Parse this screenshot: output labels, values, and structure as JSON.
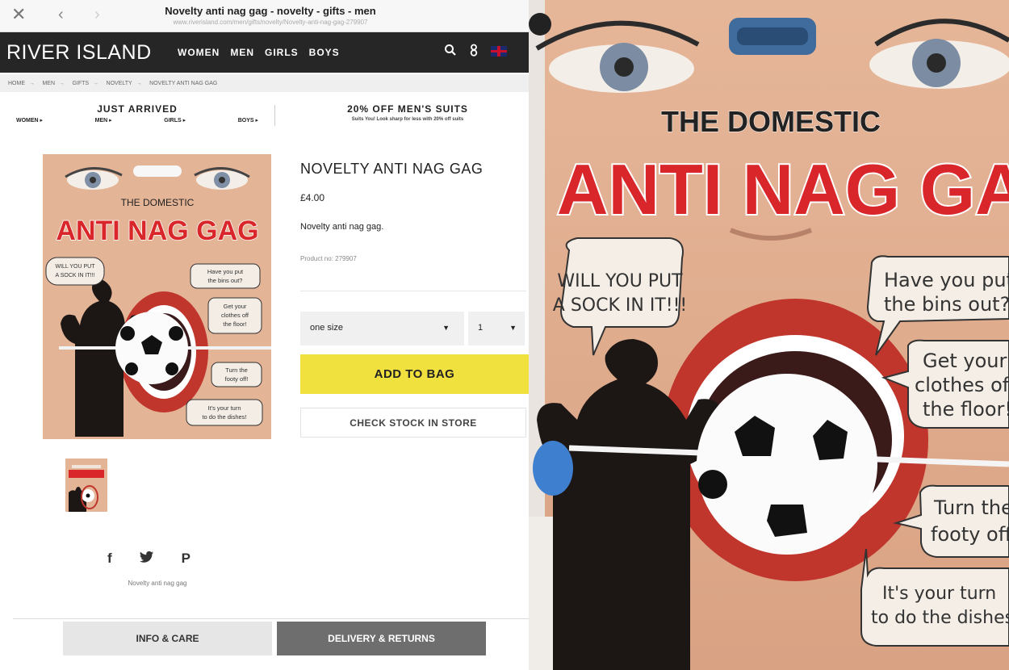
{
  "browser": {
    "page_title": "Novelty anti nag gag - novelty - gifts - men",
    "url": "www.riverisland.com/men/gifts/novelty/Novelty-anti-nag-gag-279907"
  },
  "site": {
    "brand": "RIVER ISLAND",
    "nav": [
      "WOMEN",
      "MEN",
      "GIRLS",
      "BOYS"
    ]
  },
  "breadcrumb": [
    "HOME",
    "MEN",
    "GIFTS",
    "NOVELTY",
    "NOVELTY ANTI NAG GAG"
  ],
  "promo": {
    "left_title": "JUST ARRIVED",
    "left_links": [
      "WOMEN ▸",
      "MEN ▸",
      "GIRLS ▸",
      "BOYS ▸"
    ],
    "right_title": "20% OFF MEN'S SUITS",
    "right_sub": "Suits You! Look sharp for less with 20% off suits"
  },
  "product": {
    "title": "NOVELTY ANTI NAG GAG",
    "price": "£4.00",
    "description": "Novelty anti nag gag.",
    "product_no": "Product no: 279907",
    "size_value": "one size",
    "qty_value": "1",
    "add_to_bag": "ADD TO BAG",
    "check_stock": "CHECK STOCK IN STORE",
    "share_caption": "Novelty anti nag gag"
  },
  "tabs": {
    "info": "INFO & CARE",
    "delivery": "DELIVERY & RETURNS"
  },
  "package": {
    "line1": "THE DOMESTIC",
    "line2": "ANTI NAG GAG",
    "bubble1_a": "WILL YOU PUT",
    "bubble1_b": "A SOCK IN IT!!!",
    "bubble2_a": "Have you put",
    "bubble2_b": "the bins out?",
    "bubble3_a": "Get your",
    "bubble3_b": "clothes off",
    "bubble3_c": "the floor!",
    "bubble4_a": "Turn the",
    "bubble4_b": "footy off!",
    "bubble5_a": "It's your turn",
    "bubble5_b": "to do the dishes!"
  },
  "photo_crop": {
    "line1": "THE DOMESTIC",
    "line2": "ANTI NAG GAG",
    "bubble1_a": "WILL YOU PUT",
    "bubble1_b": "A SOCK IN IT!!!",
    "bubble2_a": "Have you put",
    "bubble2_b": "the bins out?",
    "bubble3_a": "Get your",
    "bubble3_b": "clothes of",
    "bubble3_c": "the floor!",
    "bubble4_a": "Turn the",
    "bubble4_b": "footy off",
    "bubble5_a": "It's your turn",
    "bubble5_b": "to do the dishes"
  },
  "colors": {
    "nav_bg": "#262626",
    "add_to_bag": "#f0e13e",
    "delivery_tab": "#6e6e6e",
    "package_red": "#d8262a"
  },
  "icons": [
    "close-icon",
    "back-icon",
    "forward-icon",
    "search-icon",
    "account-icon",
    "flag-icon",
    "facebook-icon",
    "twitter-icon",
    "pinterest-icon",
    "chevron-down-icon"
  ]
}
